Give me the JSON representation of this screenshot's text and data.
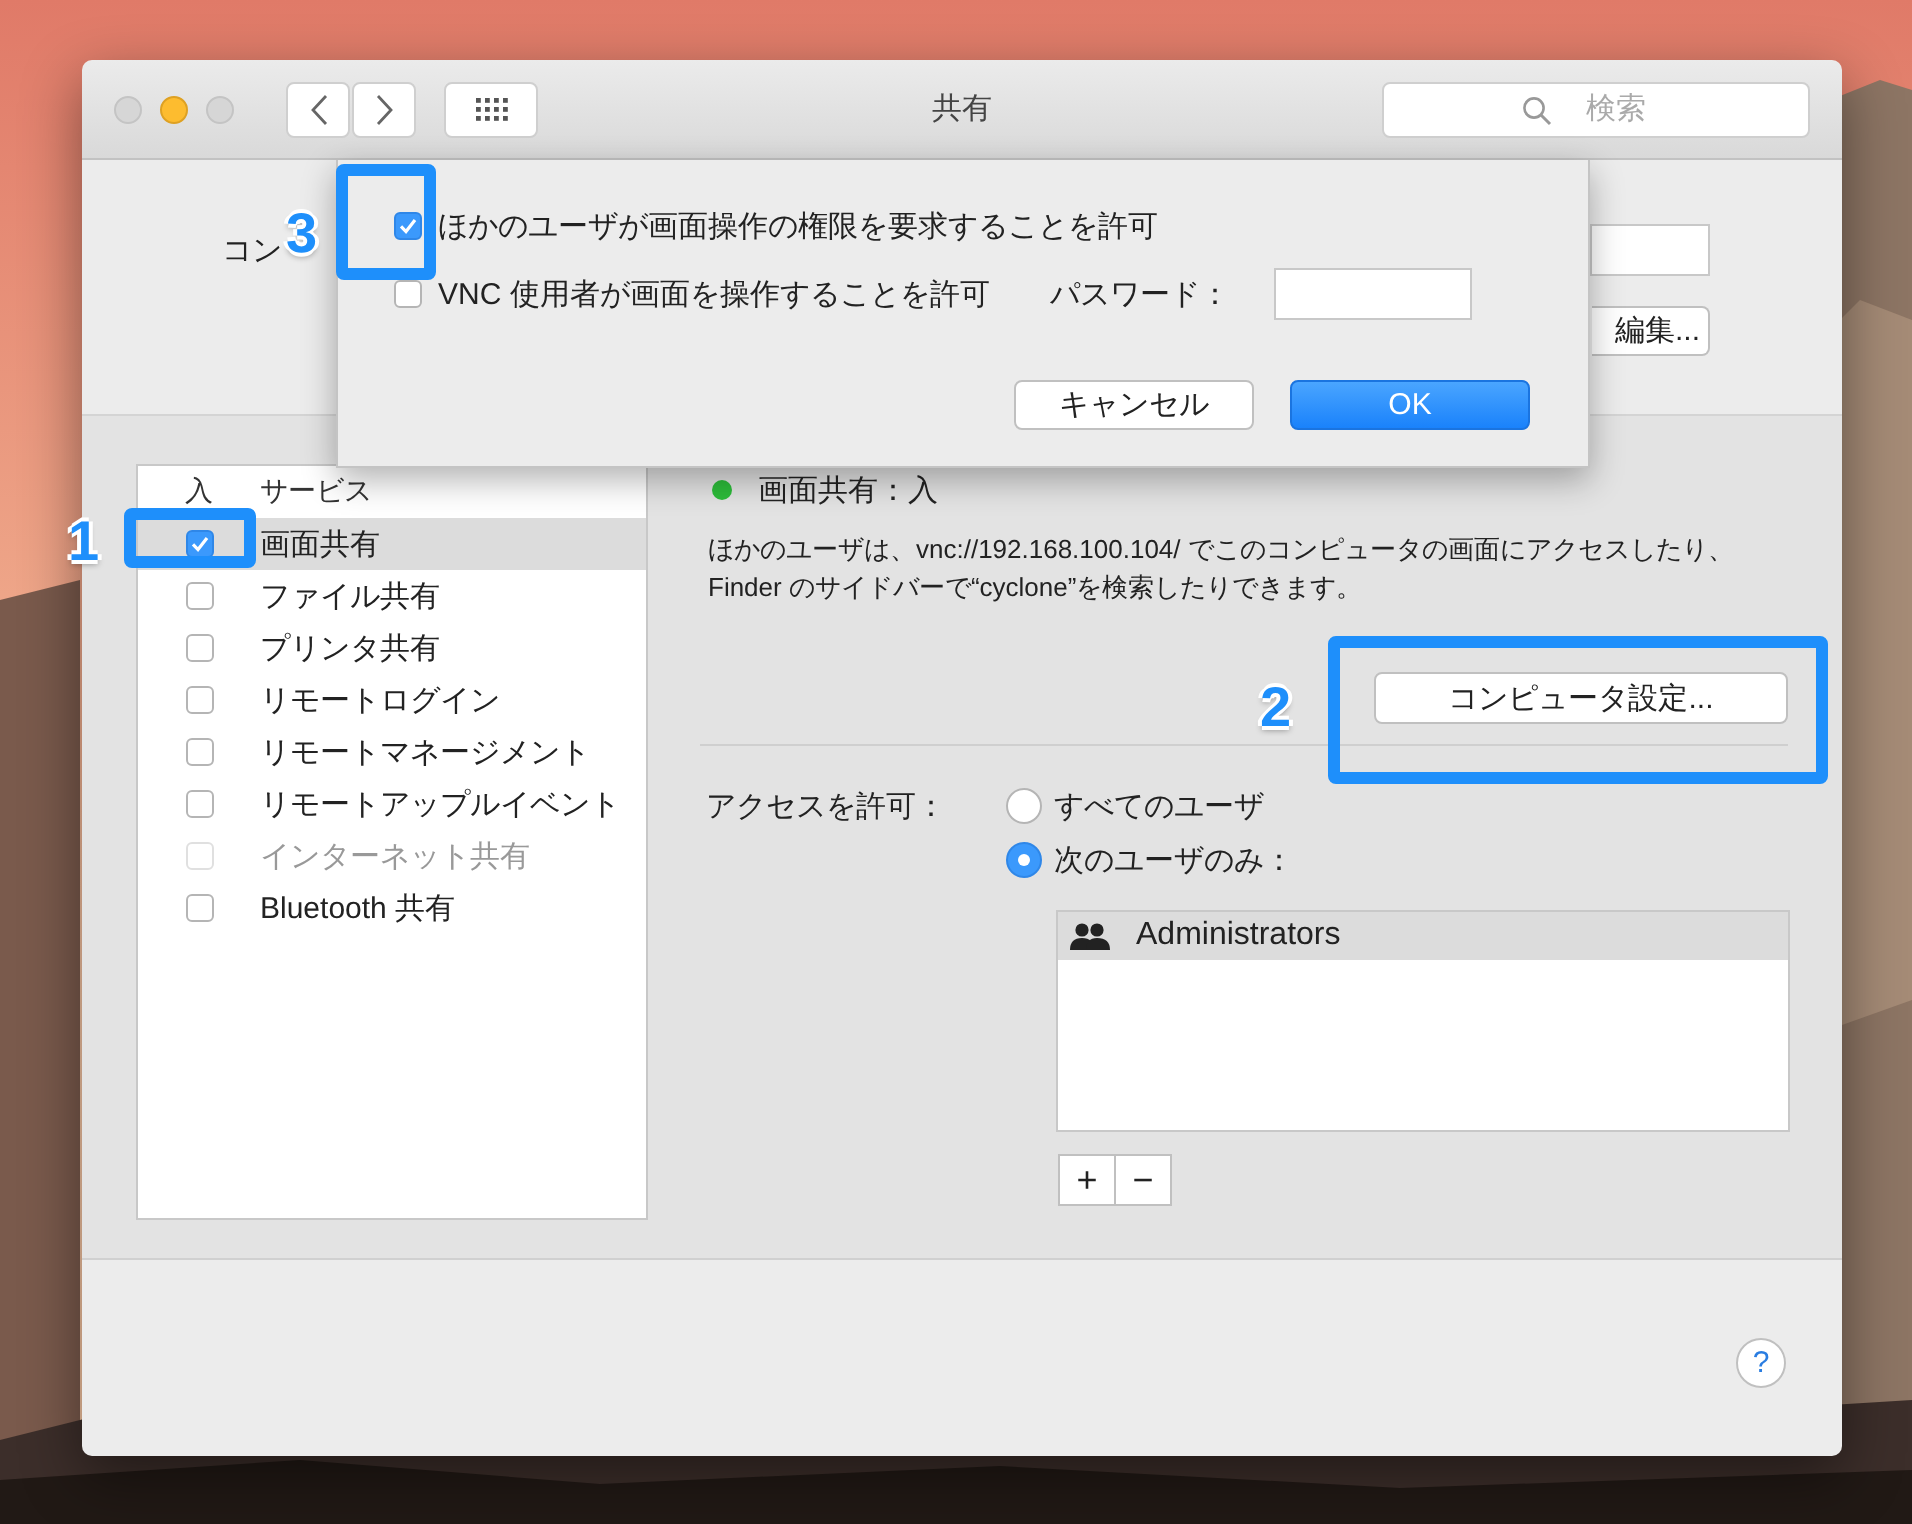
{
  "window": {
    "title": "共有",
    "search": {
      "placeholder": "検索"
    }
  },
  "computer_name": {
    "label": "コン",
    "button": "編集..."
  },
  "sheet": {
    "options": [
      {
        "label": "ほかのユーザが画面操作の権限を要求することを許可",
        "checked": true
      },
      {
        "label": "VNC 使用者が画面を操作することを許可",
        "checked": false
      }
    ],
    "password_label": "パスワード：",
    "buttons": [
      {
        "label": "キャンセル",
        "kind": "normal"
      },
      {
        "label": "OK",
        "kind": "default"
      }
    ]
  },
  "services": {
    "columns": [
      "入",
      "サービス"
    ],
    "items": [
      {
        "name": "画面共有",
        "checked": true,
        "selected": true,
        "disabled": false
      },
      {
        "name": "ファイル共有",
        "checked": false,
        "selected": false,
        "disabled": false
      },
      {
        "name": "プリンタ共有",
        "checked": false,
        "selected": false,
        "disabled": false
      },
      {
        "name": "リモートログイン",
        "checked": false,
        "selected": false,
        "disabled": false
      },
      {
        "name": "リモートマネージメント",
        "checked": false,
        "selected": false,
        "disabled": false
      },
      {
        "name": "リモートアップルイベント",
        "checked": false,
        "selected": false,
        "disabled": false
      },
      {
        "name": "インターネット共有",
        "checked": false,
        "selected": false,
        "disabled": true
      },
      {
        "name": "Bluetooth 共有",
        "checked": false,
        "selected": false,
        "disabled": false
      }
    ]
  },
  "status": {
    "on": true,
    "text": "画面共有：入",
    "description": "ほかのユーザは、vnc://192.168.100.104/ でこのコンピュータの画面にアクセスしたり、Finder のサイドバーで“cyclone”を検索したりできます。"
  },
  "settings_button": "コンピュータ設定...",
  "access": {
    "label": "アクセスを許可：",
    "options": [
      {
        "label": "すべてのユーザ",
        "selected": false
      },
      {
        "label": "次のユーザのみ：",
        "selected": true
      }
    ],
    "users": [
      {
        "name": "Administrators",
        "selected": true
      }
    ],
    "buttons": [
      "+",
      "−"
    ]
  },
  "help_button": "?",
  "annotations": [
    {
      "label": "1"
    },
    {
      "label": "2"
    },
    {
      "label": "3"
    }
  ]
}
